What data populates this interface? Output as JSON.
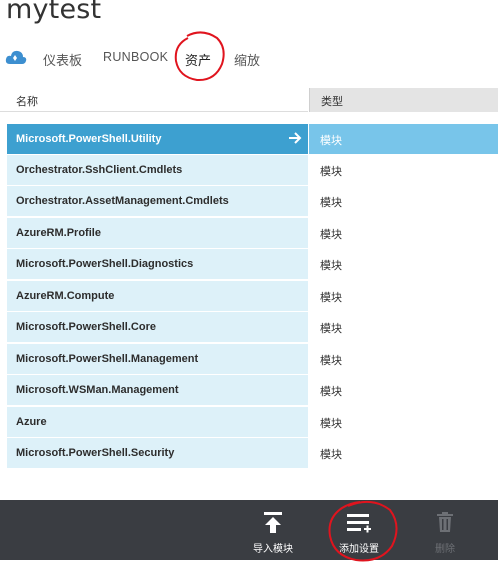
{
  "page": {
    "title": "mytest"
  },
  "tabs": [
    {
      "label": "仪表板",
      "active": false
    },
    {
      "label": "RUNBOOK",
      "active": false
    },
    {
      "label": "资产",
      "active": true
    },
    {
      "label": "缩放",
      "active": false
    }
  ],
  "table": {
    "columns": [
      "名称",
      "类型"
    ],
    "rows": [
      {
        "name": "Microsoft.PowerShell.Utility",
        "type": "模块",
        "selected": true
      },
      {
        "name": "Orchestrator.SshClient.Cmdlets",
        "type": "模块"
      },
      {
        "name": "Orchestrator.AssetManagement.Cmdlets",
        "type": "模块"
      },
      {
        "name": "AzureRM.Profile",
        "type": "模块"
      },
      {
        "name": "Microsoft.PowerShell.Diagnostics",
        "type": "模块"
      },
      {
        "name": "AzureRM.Compute",
        "type": "模块"
      },
      {
        "name": "Microsoft.PowerShell.Core",
        "type": "模块"
      },
      {
        "name": "Microsoft.PowerShell.Management",
        "type": "模块"
      },
      {
        "name": "Microsoft.WSMan.Management",
        "type": "模块"
      },
      {
        "name": "Azure",
        "type": "模块"
      },
      {
        "name": "Microsoft.PowerShell.Security",
        "type": "模块"
      }
    ]
  },
  "commands": {
    "import_module": {
      "label": "导入模块",
      "icon": "upload-arrow-icon"
    },
    "add_setting": {
      "label": "添加设置",
      "icon": "add-list-icon"
    },
    "delete": {
      "label": "删除",
      "icon": "trash-icon",
      "disabled": true
    }
  },
  "colors": {
    "selected_row": "#3da0d0",
    "selected_type": "#78c5ea",
    "row_bg": "#ddf1f9",
    "command_bar": "#3a3d42",
    "annotation": "#e0141e"
  }
}
